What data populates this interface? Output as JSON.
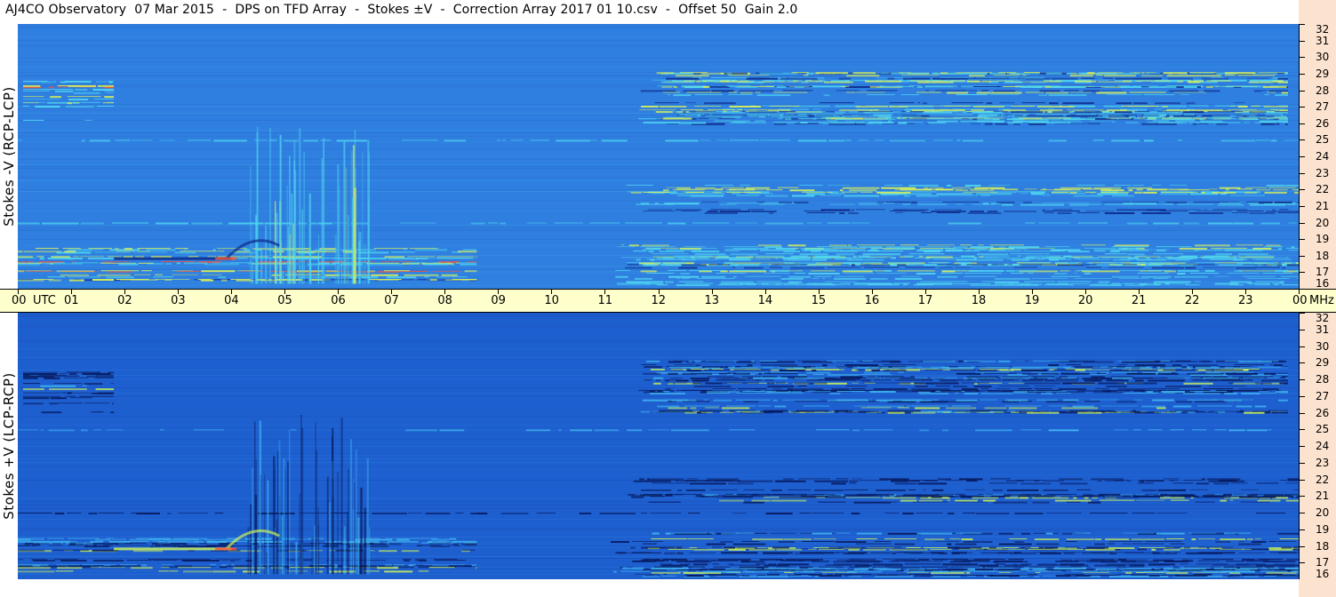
{
  "title": "AJ4CO Observatory  07 Mar 2015  -  DPS on TFD Array  -  Stokes ±V  -  Correction Array 2017 01 10.csv  -  Offset 50  Gain 2.0",
  "chart_data": {
    "type": "heatmap",
    "x_axis": {
      "unit_label": "UTC",
      "ticks": [
        "00",
        "01",
        "02",
        "03",
        "04",
        "05",
        "06",
        "07",
        "08",
        "09",
        "10",
        "11",
        "12",
        "13",
        "14",
        "15",
        "16",
        "17",
        "18",
        "19",
        "20",
        "21",
        "22",
        "23",
        "00"
      ],
      "range": [
        0,
        24
      ]
    },
    "y_axis": {
      "unit_label": "MHz",
      "ticks": [
        "32",
        "31",
        "30",
        "29",
        "28",
        "27",
        "26",
        "25",
        "24",
        "23",
        "22",
        "21",
        "20",
        "19",
        "18",
        "17",
        "16"
      ],
      "range": [
        16,
        32
      ]
    },
    "panels": [
      {
        "label": "Stokes -V (RCP-LCP)",
        "colors": {
          "background": "#2f7fe0",
          "low": "#0d2a8a",
          "mid": "#4fd6f0",
          "high": "#d8f05a",
          "peak": "#ff5030"
        }
      },
      {
        "label": "Stokes +V (LCP-RCP)",
        "colors": {
          "background": "#1e5fd0",
          "low": "#061a5e",
          "mid": "#3fb4ef",
          "high": "#c8ef5a",
          "peak": "#ff5030"
        }
      }
    ]
  }
}
